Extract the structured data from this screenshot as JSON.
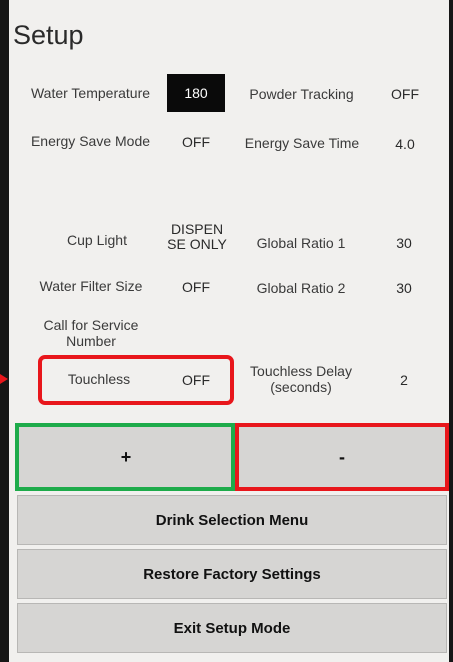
{
  "screen": {
    "title": "Setup"
  },
  "settings": {
    "water_temperature": {
      "label": "Water Temperature",
      "value": "180"
    },
    "powder_tracking": {
      "label": "Powder Tracking",
      "value": "OFF"
    },
    "energy_save_mode": {
      "label": "Energy Save Mode",
      "value": "OFF"
    },
    "energy_save_time": {
      "label": "Energy Save Time",
      "value": "4.0"
    },
    "cup_light": {
      "label": "Cup Light",
      "value_line1": "DISPEN",
      "value_line2": "SE ONLY"
    },
    "global_ratio_1": {
      "label": "Global Ratio 1",
      "value": "30"
    },
    "water_filter_size": {
      "label": "Water Filter Size",
      "value": "OFF"
    },
    "global_ratio_2": {
      "label": "Global Ratio 2",
      "value": "30"
    },
    "call_for_service": {
      "label_line1": "Call for Service",
      "label_line2": "Number"
    },
    "touchless": {
      "label": "Touchless",
      "value": "OFF"
    },
    "touchless_delay": {
      "label_line1": "Touchless Delay",
      "label_line2": "(seconds)",
      "value": "2"
    }
  },
  "buttons": {
    "increment": "+",
    "decrement": "-",
    "drink_selection_menu": "Drink Selection Menu",
    "restore_factory_settings": "Restore Factory Settings",
    "exit_setup_mode": "Exit Setup Mode"
  },
  "colors": {
    "highlight_red": "#e8161b",
    "highlight_green": "#1eab4a",
    "selected_value_bg": "#0a0a0a",
    "screen_bg": "#f1f0ee",
    "button_bg": "#d6d5d3"
  }
}
